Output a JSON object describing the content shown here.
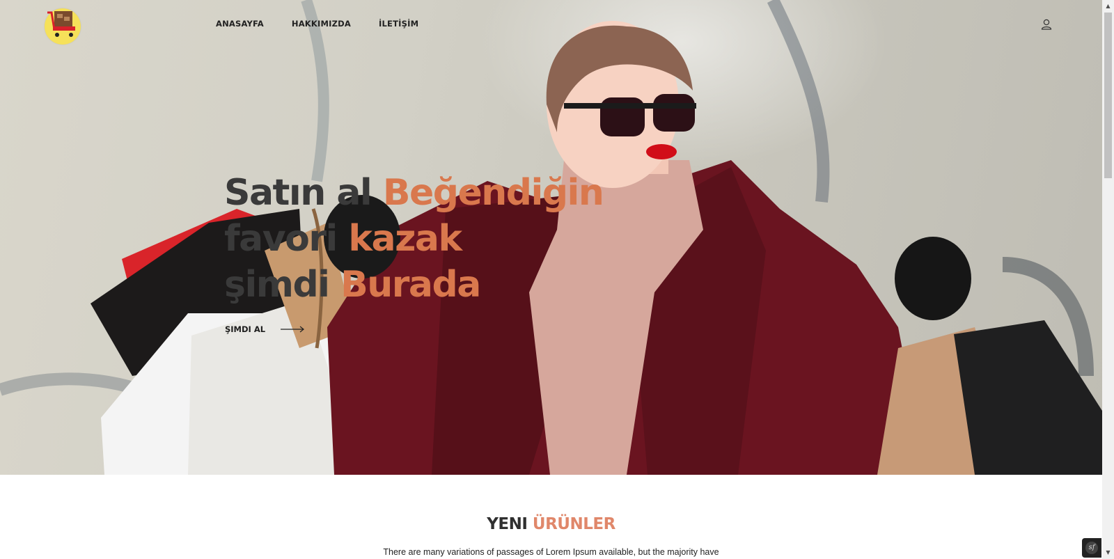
{
  "header": {
    "logo_icon": "shopping-cart-icon",
    "nav": [
      {
        "label": "ANASAYFA"
      },
      {
        "label": "HAKKIMIZDA"
      },
      {
        "label": "İLETİŞİM"
      }
    ],
    "user_icon": "user-icon"
  },
  "hero": {
    "lines": [
      {
        "dark": "Satın al",
        "accent": "Beğendiğin"
      },
      {
        "dark": "favori",
        "accent": "kazak"
      },
      {
        "dark": "şimdi",
        "accent": "Burada"
      }
    ],
    "cta_label": "ŞIMDI AL",
    "cta_icon": "arrow-right-icon"
  },
  "products_section": {
    "title_dark": "YENI",
    "title_accent": "ÜRÜNLER",
    "description": "There are many variations of passages of Lorem Ipsum available, but the majority have"
  },
  "debug_toolbar": {
    "label": "sf"
  },
  "colors": {
    "accent": "#d9784d",
    "text_dark": "#3a3a3a",
    "title_accent": "#e0876a"
  }
}
